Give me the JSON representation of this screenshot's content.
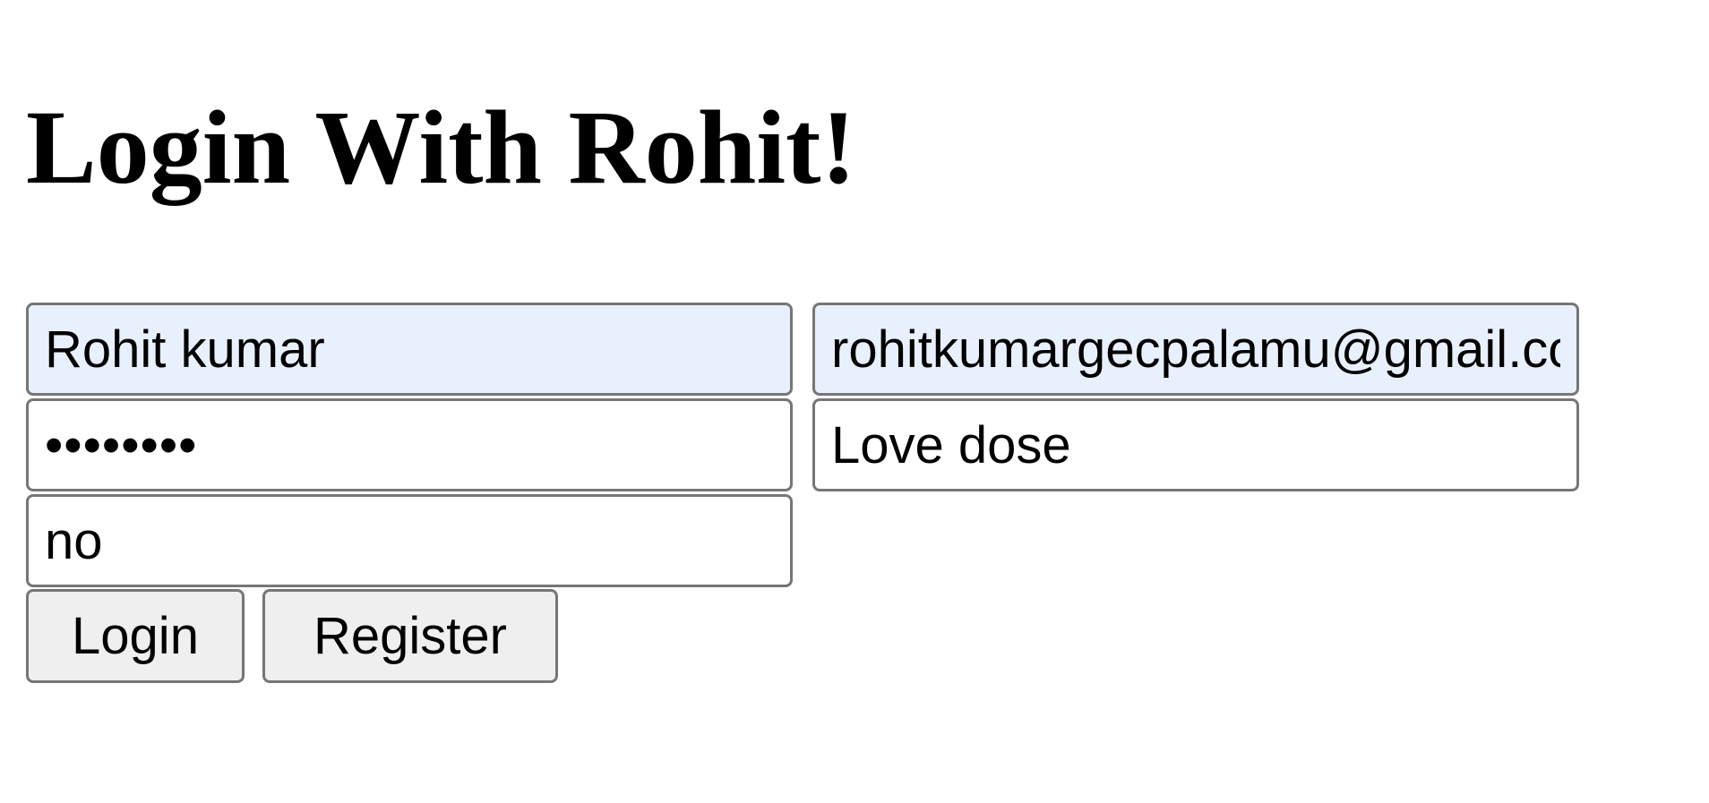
{
  "page": {
    "heading": "Login With Rohit!"
  },
  "form": {
    "name_value": "Rohit kumar",
    "email_value": "rohitkumargecpalamu@gmail.com",
    "password_value": "••••••••",
    "fourth_value": "Love dose",
    "fifth_value": "no",
    "login_label": "Login",
    "register_label": "Register"
  },
  "colors": {
    "autofill_background": "#e8f0fe",
    "button_background": "#efefef",
    "border": "#767676"
  }
}
